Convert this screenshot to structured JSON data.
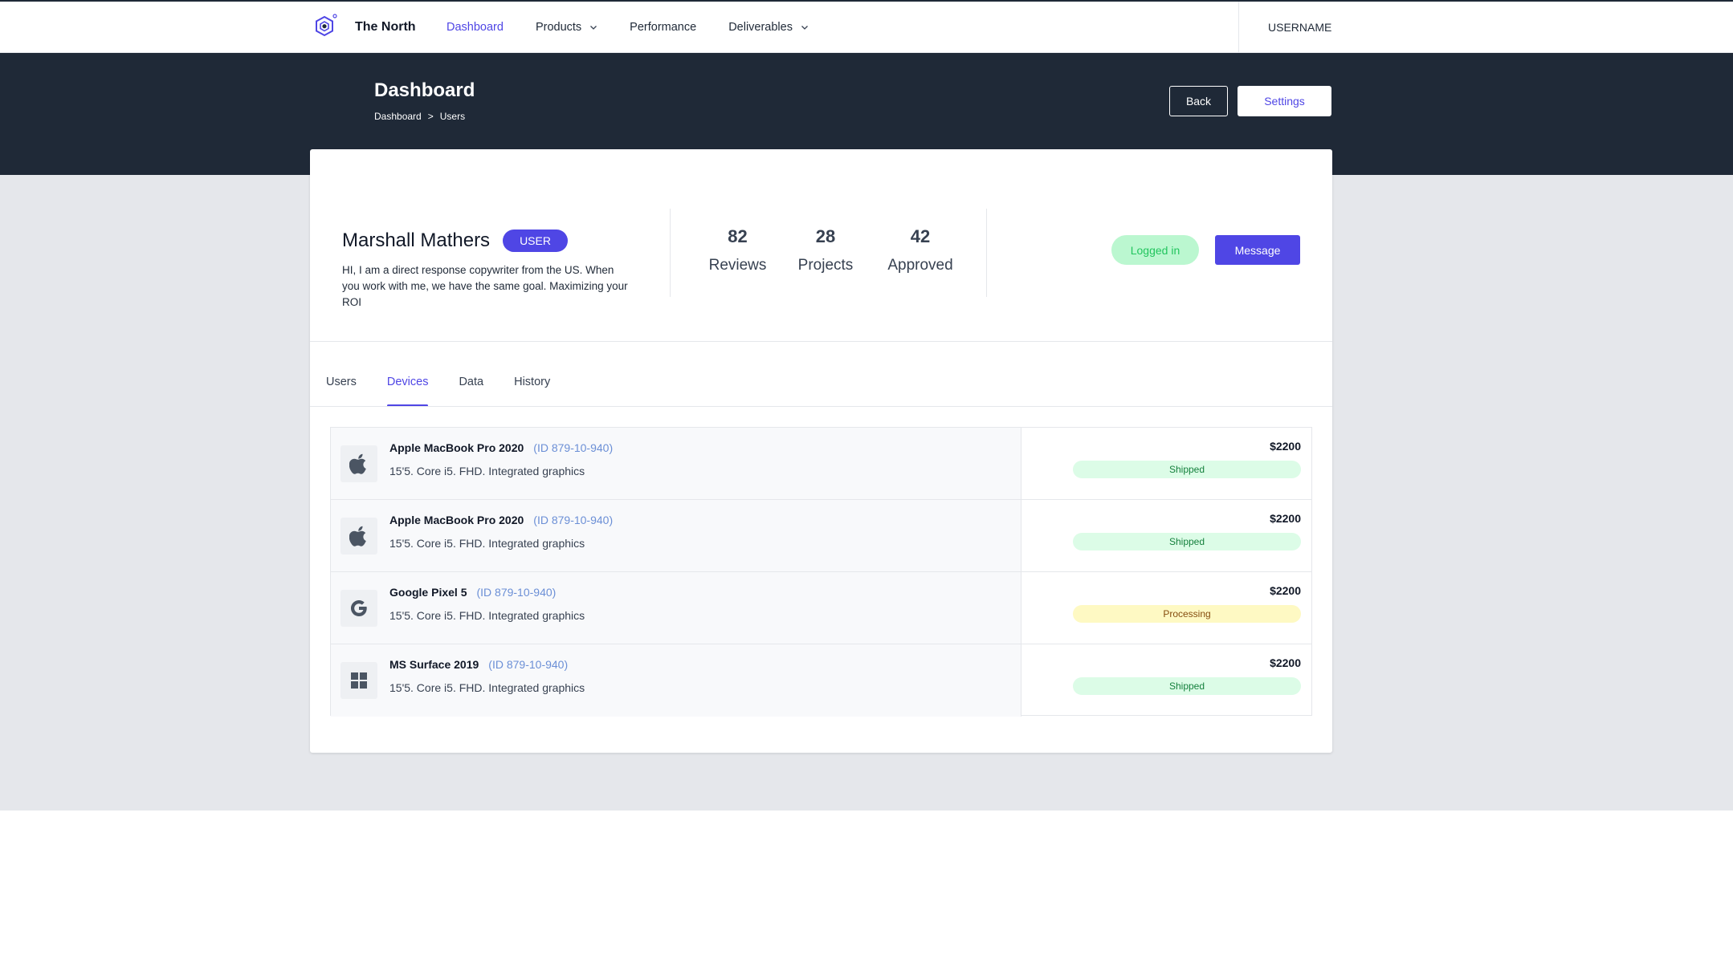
{
  "brand": {
    "name": "The North",
    "logo_icon": "hexagon-logo-icon"
  },
  "nav": {
    "items": [
      {
        "label": "Dashboard",
        "active": true,
        "dropdown": false
      },
      {
        "label": "Products",
        "active": false,
        "dropdown": true
      },
      {
        "label": "Performance",
        "active": false,
        "dropdown": false
      },
      {
        "label": "Deliverables",
        "active": false,
        "dropdown": true
      }
    ],
    "username": "USERNAME"
  },
  "header": {
    "title": "Dashboard",
    "breadcrumb": [
      "Dashboard",
      "Users"
    ],
    "breadcrumb_sep": ">",
    "back_label": "Back",
    "settings_label": "Settings"
  },
  "profile": {
    "name": "Marshall Mathers",
    "role": "USER",
    "bio": "HI, I am a direct response copywriter from the US. When you work with me, we have the same goal. Maximizing your ROI",
    "stats": [
      {
        "value": "82",
        "label": "Reviews"
      },
      {
        "value": "28",
        "label": "Projects"
      },
      {
        "value": "42",
        "label": "Approved"
      }
    ],
    "status_label": "Logged in",
    "message_label": "Message"
  },
  "tabs": [
    {
      "label": "Users",
      "active": false
    },
    {
      "label": "Devices",
      "active": true
    },
    {
      "label": "Data",
      "active": false
    },
    {
      "label": "History",
      "active": false
    }
  ],
  "devices": [
    {
      "icon": "apple-icon",
      "name": "Apple MacBook Pro 2020",
      "id": "(ID 879-10-940)",
      "spec": "15'5. Core i5. FHD. Integrated graphics",
      "price": "$2200",
      "status": "Shipped"
    },
    {
      "icon": "apple-icon",
      "name": "Apple MacBook Pro 2020",
      "id": "(ID 879-10-940)",
      "spec": "15'5. Core i5. FHD. Integrated graphics",
      "price": "$2200",
      "status": "Shipped"
    },
    {
      "icon": "google-icon",
      "name": "Google Pixel 5",
      "id": "(ID 879-10-940)",
      "spec": "15'5. Core i5. FHD. Integrated graphics",
      "price": "$2200",
      "status": "Processing"
    },
    {
      "icon": "windows-icon",
      "name": "MS Surface 2019",
      "id": "(ID 879-10-940)",
      "spec": "15'5. Core i5. FHD. Integrated graphics",
      "price": "$2200",
      "status": "Shipped"
    }
  ],
  "colors": {
    "accent": "#4f46e5",
    "header_bg": "#1f2937",
    "shipped_bg": "#dcfce7",
    "processing_bg": "#fef9c3",
    "logged_in_bg": "#bbf7d0"
  }
}
